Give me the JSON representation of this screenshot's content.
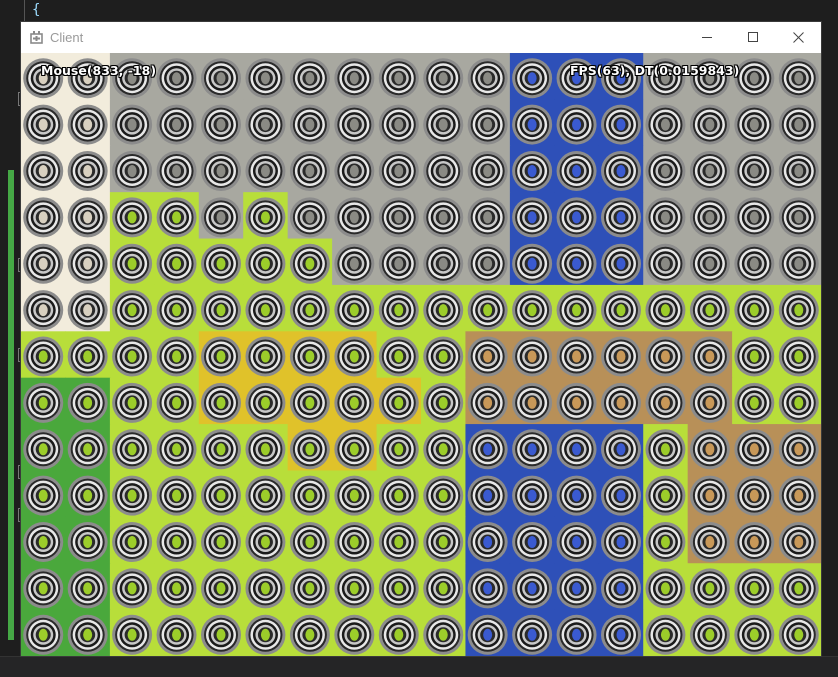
{
  "editor": {
    "brace": "{"
  },
  "window": {
    "title": "Client"
  },
  "hud": {
    "mouse": "Mouse(833, -18)",
    "fps": "FPS(63), DT(0.0159843)"
  },
  "icons": {
    "app": "game-controller-icon",
    "minimize": "minimize-icon",
    "maximize": "maximize-icon",
    "close": "close-icon"
  },
  "colors": {
    "cream": "#f2ecdc",
    "stone": "#a8a8a0",
    "grass": "#b8de3a",
    "sand": "#e0c22a",
    "dark_grass": "#4aa83c",
    "water": "#2e50b8",
    "dirt": "#b89058",
    "editor_accent": "#45a845"
  },
  "game": {
    "terrain_key": {
      "C": "cream",
      "S": "stone",
      "G": "grass",
      "Y": "sand",
      "D": "dark_grass",
      "W": "water",
      "B": "dirt"
    },
    "terrain_rows": [
      "CCSSSSSSSSSWWWSSSS",
      "CCSSSSSSSSSWWWSSSS",
      "CCSSSSSSSSSWWWSSSS",
      "CCGGSGSSSSSWWWSSSS",
      "CCGGGGGSSSSWWWSSSS",
      "CCGGGGGGGGGGGGGGGG",
      "GGGGYYYYGGBBBBBBGG",
      "DDGGYYYYYGBBBBBBGG",
      "DDGGGGYYGGWWWWGBBB",
      "DDGGGGGGGGWWWWGBBB",
      "DDGGGGGGGGWWWWGBBB",
      "DDGGGGGGGGWWWWGGGG",
      "DDGGGGGGGGWWWWGGGG"
    ]
  }
}
